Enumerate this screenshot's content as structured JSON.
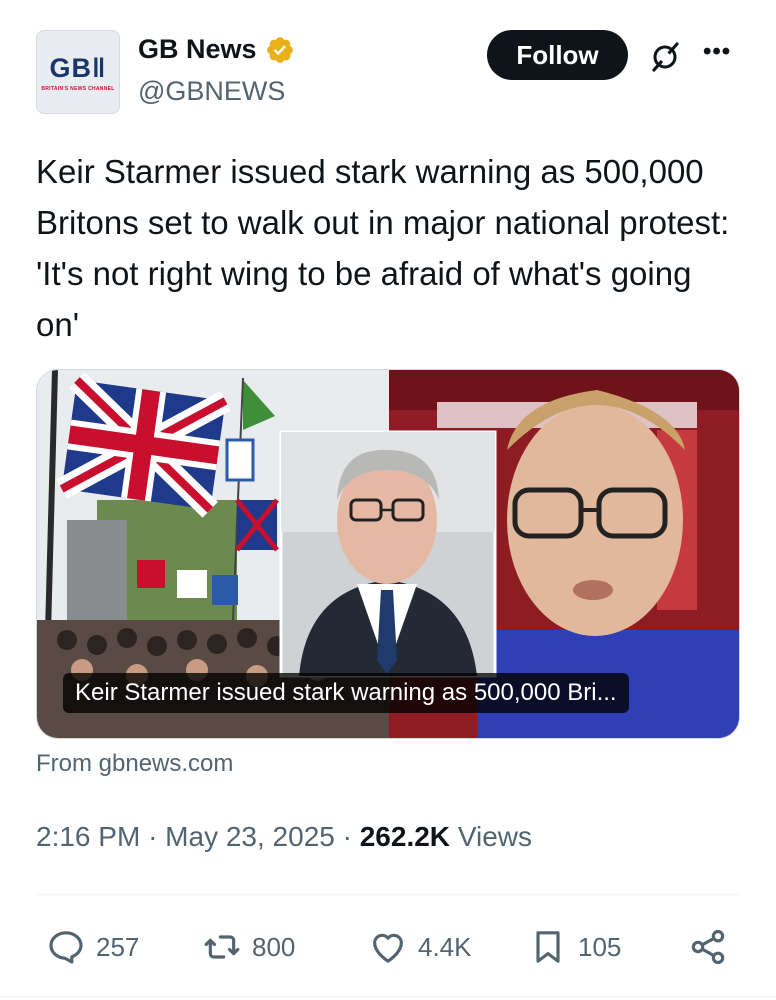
{
  "author": {
    "avatar_text": "GB‖",
    "avatar_tagline": "BRITAIN'S NEWS CHANNEL",
    "name": "GB News",
    "handle": "@GBNEWS",
    "verified_color": "#e8b019"
  },
  "header": {
    "follow_label": "Follow",
    "more_label": "•••"
  },
  "post": {
    "text": "Keir Starmer issued stark warning as 500,000 Britons set to walk out in major national protest: 'It's not right wing to be afraid of what's going on'"
  },
  "card": {
    "caption": "Keir Starmer issued stark warning as 500,000 Bri...",
    "source": "From gbnews.com"
  },
  "meta": {
    "time": "2:16 PM",
    "separator": "·",
    "date": "May 23, 2025",
    "views_count": "262.2K",
    "views_label": "Views"
  },
  "actions": {
    "replies": "257",
    "reposts": "800",
    "likes": "4.4K",
    "bookmarks": "105"
  }
}
